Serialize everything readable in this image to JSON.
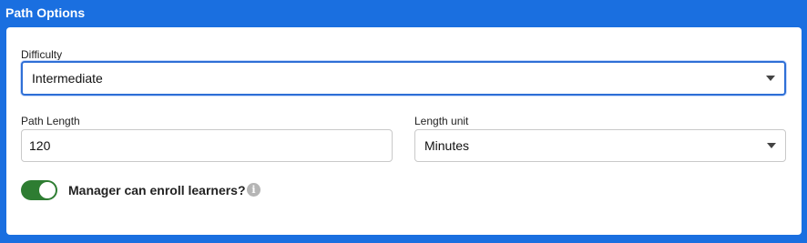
{
  "panel": {
    "title": "Path Options"
  },
  "difficulty": {
    "label": "Difficulty",
    "value": "Intermediate",
    "icon": "chevron-down-icon"
  },
  "path_length": {
    "label": "Path Length",
    "value": "120"
  },
  "length_unit": {
    "label": "Length unit",
    "value": "Minutes",
    "icon": "chevron-down-icon"
  },
  "manager_enroll": {
    "label": "Manager can enroll learners?",
    "enabled": true,
    "info_icon": "info-icon",
    "info_glyph": "i"
  },
  "colors": {
    "header_blue": "#1a6fe0",
    "toggle_green": "#2e7d32",
    "focus_blue": "#2e6fd6"
  }
}
